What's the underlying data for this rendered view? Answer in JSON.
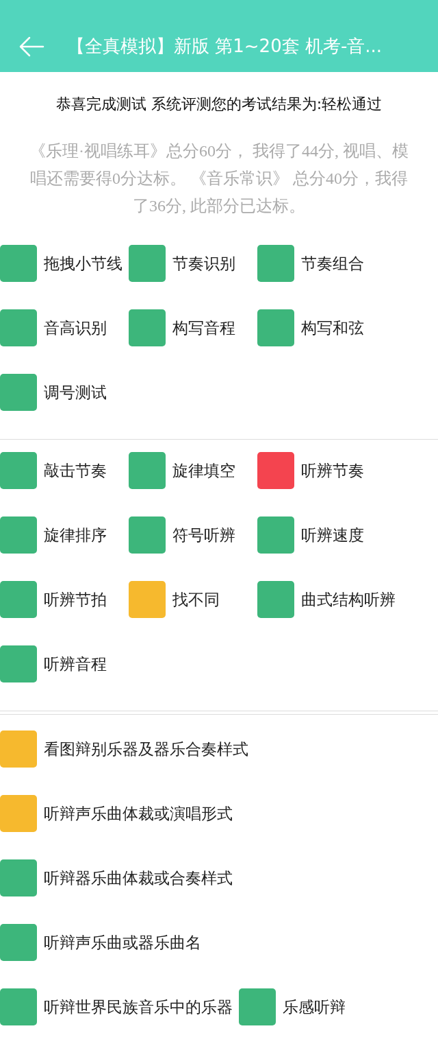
{
  "header": {
    "title": "【全真模拟】新版 第1~20套 机考-音..."
  },
  "result": {
    "headline": "恭喜完成测试 系统评测您的考试结果为:轻松通过",
    "summary_lines": [
      "《乐理·视唱练耳》总分60分， 我得了44分, 视唱、模",
      "唱还需要得0分达标。 《音乐常识》 总分40分，我得",
      "了36分, 此部分已达标。"
    ]
  },
  "sections": [
    {
      "items": [
        {
          "label": "拖拽小节线",
          "color": "#3db67b"
        },
        {
          "label": "节奏识别",
          "color": "#3db67b"
        },
        {
          "label": "节奏组合",
          "color": "#3db67b"
        },
        {
          "label": "音高识别",
          "color": "#3db67b"
        },
        {
          "label": "构写音程",
          "color": "#3db67b"
        },
        {
          "label": "构写和弦",
          "color": "#3db67b"
        },
        {
          "label": "调号测试",
          "color": "#3db67b"
        }
      ]
    },
    {
      "items": [
        {
          "label": "敲击节奏",
          "color": "#3db67b"
        },
        {
          "label": "旋律填空",
          "color": "#3db67b"
        },
        {
          "label": "听辨节奏",
          "color": "#f4444f"
        },
        {
          "label": "旋律排序",
          "color": "#3db67b"
        },
        {
          "label": "符号听辨",
          "color": "#3db67b"
        },
        {
          "label": "听辨速度",
          "color": "#3db67b"
        },
        {
          "label": "听辨节拍",
          "color": "#3db67b"
        },
        {
          "label": "找不同",
          "color": "#f6b92e"
        },
        {
          "label": "曲式结构听辨",
          "color": "#3db67b"
        },
        {
          "label": "听辨音程",
          "color": "#3db67b"
        }
      ]
    },
    {
      "items": [
        {
          "label": "看图辩别乐器及器乐合奏样式",
          "color": "#f6b92e"
        },
        {
          "label": "听辩声乐曲体裁或演唱形式",
          "color": "#f6b92e"
        },
        {
          "label": "听辩器乐曲体裁或合奏样式",
          "color": "#3db67b"
        },
        {
          "label": "听辩声乐曲或器乐曲名",
          "color": "#3db67b"
        },
        {
          "label": "听辩世界民族音乐中的乐器",
          "color": "#3db67b"
        },
        {
          "label": "乐感听辩",
          "color": "#3db67b"
        }
      ]
    }
  ]
}
